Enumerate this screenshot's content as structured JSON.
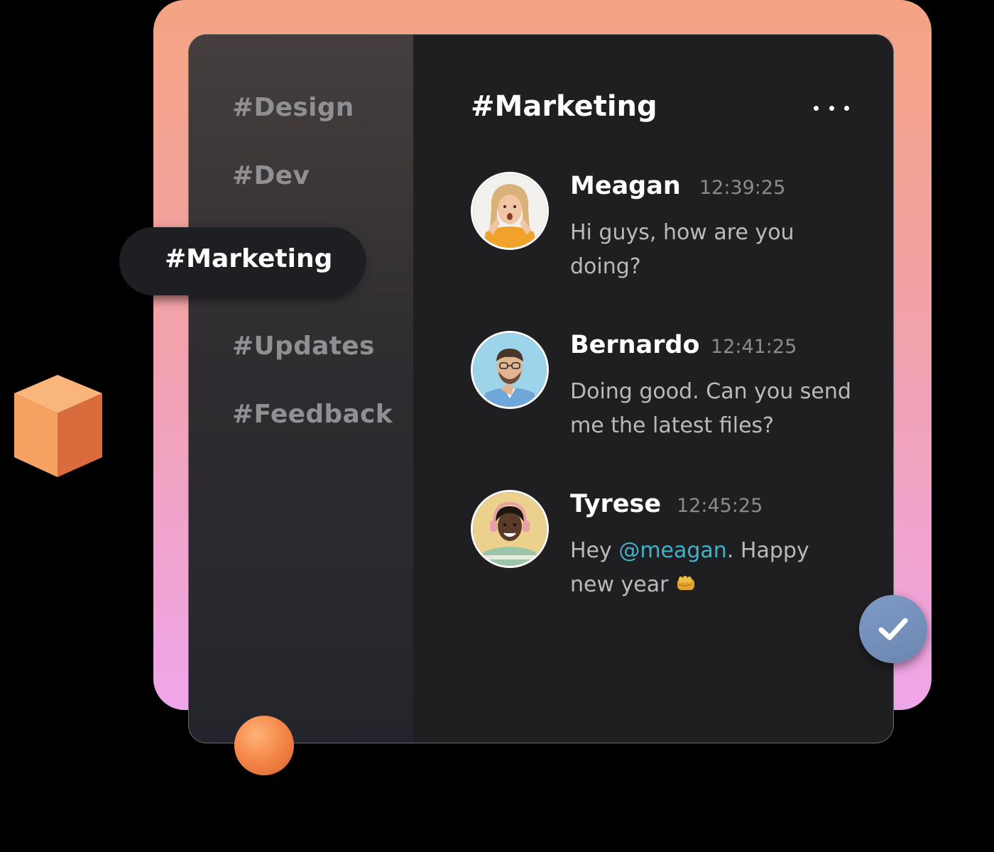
{
  "sidebar": {
    "channels": [
      {
        "label": "#Design"
      },
      {
        "label": "#Dev"
      },
      {
        "label": "#Marketing",
        "active": true
      },
      {
        "label": "#Updates"
      },
      {
        "label": "#Feedback"
      }
    ]
  },
  "main": {
    "title": "#Marketing",
    "more_icon": "more-horizontal-icon"
  },
  "messages": [
    {
      "name": "Meagan",
      "time": "12:39:25",
      "text": "Hi guys, how are you doing?"
    },
    {
      "name": "Bernardo",
      "time": "12:41:25",
      "text": "Doing good. Can you send me the latest files?"
    },
    {
      "name": "Tyrese",
      "time": "12:45:25",
      "text_before": "Hey ",
      "mention": "@meagan",
      "text_after": ". Happy new year",
      "emoji": "fist-icon"
    }
  ],
  "check_button": {
    "icon": "check-icon"
  },
  "colors": {
    "mention": "#3fb2c8",
    "check_button": "#7590bb",
    "accent_orange": "#f58a4a"
  }
}
